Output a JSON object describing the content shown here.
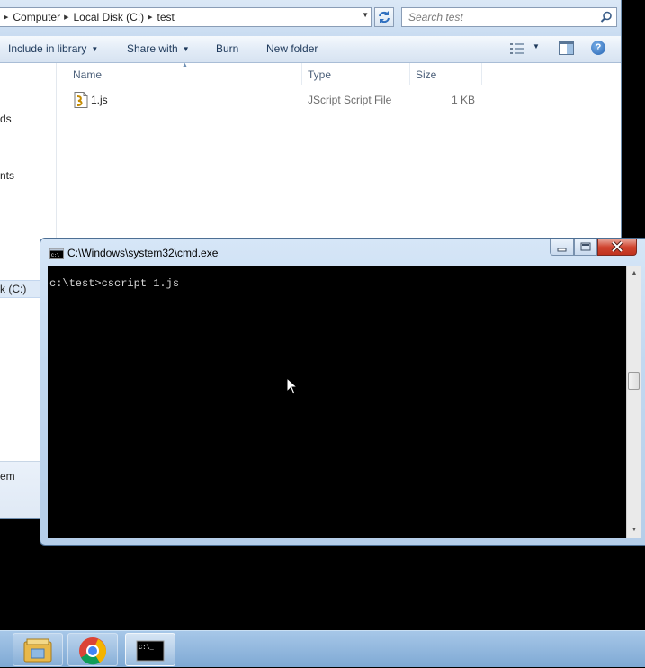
{
  "explorer": {
    "breadcrumbs": [
      "Computer",
      "Local Disk (C:)",
      "test"
    ],
    "search_placeholder": "Search test",
    "toolbar": {
      "include_in_library": "Include in library",
      "share_with": "Share with",
      "burn": "Burn",
      "new_folder": "New folder"
    },
    "nav_items": [
      "ds",
      "nts",
      "k (C:)",
      "em"
    ],
    "columns": [
      "Name",
      "Type",
      "Size"
    ],
    "files": [
      {
        "name": "1.js",
        "type": "JScript Script File",
        "size": "1 KB"
      }
    ]
  },
  "cmd": {
    "title": "C:\\Windows\\system32\\cmd.exe",
    "console_text": "c:\\test>cscript 1.js"
  },
  "taskbar": {
    "items": [
      "file-explorer-icon",
      "chrome-icon",
      "command-prompt-icon"
    ]
  },
  "colors": {
    "console_bg": "#000000",
    "console_fg": "#d4d4d4",
    "close_red": "#c7402b",
    "taskbar": "#8fb5dd"
  }
}
